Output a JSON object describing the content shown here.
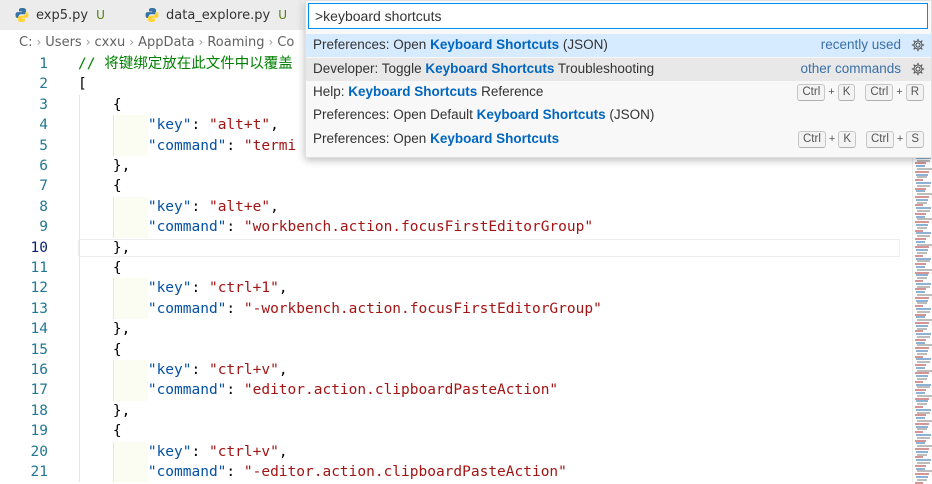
{
  "tabs": [
    {
      "name": "exp5.py",
      "status": "U"
    },
    {
      "name": "data_explore.py",
      "status": "U"
    }
  ],
  "breadcrumb": [
    "C:",
    "Users",
    "cxxu",
    "AppData",
    "Roaming",
    "Co"
  ],
  "palette": {
    "input_value": ">keyboard shortcuts",
    "items": [
      {
        "prefix": "Preferences: Open ",
        "match": "Keyboard Shortcuts",
        "suffix": " (JSON)",
        "meta": "recently used",
        "gear": true,
        "keys": []
      },
      {
        "prefix": "Developer: Toggle ",
        "match": "Keyboard Shortcuts",
        "suffix": " Troubleshooting",
        "meta": "other commands",
        "gear": true,
        "keys": []
      },
      {
        "prefix": "Help: ",
        "match": "Keyboard Shortcuts",
        "suffix": " Reference",
        "meta": "",
        "gear": false,
        "keys": [
          [
            "Ctrl",
            "K"
          ],
          [
            "Ctrl",
            "R"
          ]
        ]
      },
      {
        "prefix": "Preferences: Open Default ",
        "match": "Keyboard Shortcuts",
        "suffix": " (JSON)",
        "meta": "",
        "gear": false,
        "keys": []
      },
      {
        "prefix": "Preferences: Open ",
        "match": "Keyboard Shortcuts",
        "suffix": "",
        "meta": "",
        "gear": false,
        "keys": [
          [
            "Ctrl",
            "K"
          ],
          [
            "Ctrl",
            "S"
          ]
        ]
      }
    ]
  },
  "editor": {
    "active_line": 10,
    "lines": [
      {
        "n": "1",
        "parts": [
          [
            "comment",
            "// 将键绑定放在此文件中以覆盖"
          ]
        ]
      },
      {
        "n": "2",
        "parts": [
          [
            "plain",
            "["
          ]
        ]
      },
      {
        "n": "3",
        "parts": [
          [
            "plain",
            "    {"
          ]
        ]
      },
      {
        "n": "4",
        "parts": [
          [
            "plain",
            "        "
          ],
          [
            "key",
            "\"key\""
          ],
          [
            "plain",
            ": "
          ],
          [
            "str",
            "\"alt+t\""
          ],
          [
            "plain",
            ","
          ]
        ]
      },
      {
        "n": "5",
        "parts": [
          [
            "plain",
            "        "
          ],
          [
            "key",
            "\"command\""
          ],
          [
            "plain",
            ": "
          ],
          [
            "str",
            "\"termi"
          ]
        ]
      },
      {
        "n": "6",
        "parts": [
          [
            "plain",
            "    },"
          ]
        ]
      },
      {
        "n": "7",
        "parts": [
          [
            "plain",
            "    {"
          ]
        ]
      },
      {
        "n": "8",
        "parts": [
          [
            "plain",
            "        "
          ],
          [
            "key",
            "\"key\""
          ],
          [
            "plain",
            ": "
          ],
          [
            "str",
            "\"alt+e\""
          ],
          [
            "plain",
            ","
          ]
        ]
      },
      {
        "n": "9",
        "parts": [
          [
            "plain",
            "        "
          ],
          [
            "key",
            "\"command\""
          ],
          [
            "plain",
            ": "
          ],
          [
            "str",
            "\"workbench.action.focusFirstEditorGroup\""
          ]
        ]
      },
      {
        "n": "10",
        "parts": [
          [
            "plain",
            "    },"
          ]
        ]
      },
      {
        "n": "11",
        "parts": [
          [
            "plain",
            "    {"
          ]
        ]
      },
      {
        "n": "12",
        "parts": [
          [
            "plain",
            "        "
          ],
          [
            "key",
            "\"key\""
          ],
          [
            "plain",
            ": "
          ],
          [
            "str",
            "\"ctrl+1\""
          ],
          [
            "plain",
            ","
          ]
        ]
      },
      {
        "n": "13",
        "parts": [
          [
            "plain",
            "        "
          ],
          [
            "key",
            "\"command\""
          ],
          [
            "plain",
            ": "
          ],
          [
            "str",
            "\"-workbench.action.focusFirstEditorGroup\""
          ]
        ]
      },
      {
        "n": "14",
        "parts": [
          [
            "plain",
            "    },"
          ]
        ]
      },
      {
        "n": "15",
        "parts": [
          [
            "plain",
            "    {"
          ]
        ]
      },
      {
        "n": "16",
        "parts": [
          [
            "plain",
            "        "
          ],
          [
            "key",
            "\"key\""
          ],
          [
            "plain",
            ": "
          ],
          [
            "str",
            "\"ctrl+v\""
          ],
          [
            "plain",
            ","
          ]
        ]
      },
      {
        "n": "17",
        "parts": [
          [
            "plain",
            "        "
          ],
          [
            "key",
            "\"command\""
          ],
          [
            "plain",
            ": "
          ],
          [
            "str",
            "\"editor.action.clipboardPasteAction\""
          ]
        ]
      },
      {
        "n": "18",
        "parts": [
          [
            "plain",
            "    },"
          ]
        ]
      },
      {
        "n": "19",
        "parts": [
          [
            "plain",
            "    {"
          ]
        ]
      },
      {
        "n": "20",
        "parts": [
          [
            "plain",
            "        "
          ],
          [
            "key",
            "\"key\""
          ],
          [
            "plain",
            ": "
          ],
          [
            "str",
            "\"ctrl+v\""
          ],
          [
            "plain",
            ","
          ]
        ]
      },
      {
        "n": "21",
        "parts": [
          [
            "plain",
            "        "
          ],
          [
            "key",
            "\"command\""
          ],
          [
            "plain",
            ": "
          ],
          [
            "str",
            "\"-editor.action.clipboardPasteAction\""
          ]
        ]
      }
    ]
  },
  "colors": {
    "accent": "#0090f1",
    "match": "#0066bf",
    "line_number": "#237893",
    "selected_item": "#d6ebff"
  },
  "icons": {
    "tab": "python-icon",
    "palette_action": "gear-icon"
  }
}
